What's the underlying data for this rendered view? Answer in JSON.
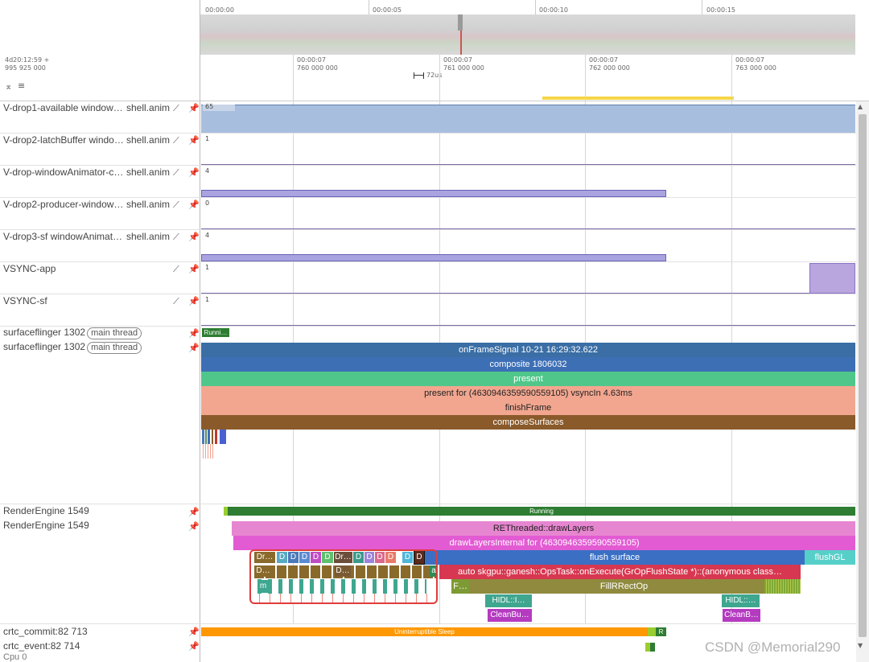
{
  "overview": {
    "ticks": [
      "00:00:00",
      "00:00:05",
      "00:00:10",
      "00:00:15"
    ]
  },
  "timeline": {
    "offset_line1": "4d20:12:59  +",
    "offset_line2": "995 925 000",
    "ticks": [
      {
        "l1": "00:00:07",
        "l2": "760 000 000"
      },
      {
        "l1": "00:00:07",
        "l2": "761 000 000"
      },
      {
        "l1": "00:00:07",
        "l2": "762 000 000"
      },
      {
        "l1": "00:00:07",
        "l2": "763 000 000"
      }
    ],
    "scale_label": "72us"
  },
  "tracks": [
    {
      "name": "V-drop1-available window…",
      "proc": "shell.anim",
      "value": "65"
    },
    {
      "name": "V-drop2-latchBuffer windo…",
      "proc": "shell.anim",
      "value": "1"
    },
    {
      "name": "V-drop-windowAnimator-c…",
      "proc": "shell.anim",
      "value": "4"
    },
    {
      "name": "V-drop2-producer-window…",
      "proc": "shell.anim",
      "value": "0"
    },
    {
      "name": "V-drop3-sf windowAnimat…",
      "proc": "shell.anim",
      "value": "4"
    },
    {
      "name": "VSYNC-app",
      "proc": "",
      "value": "1"
    },
    {
      "name": "VSYNC-sf",
      "proc": "",
      "value": "1"
    }
  ],
  "sf_state": {
    "name": "surfaceflinger 1302",
    "badge": "main thread",
    "state": "Runni…"
  },
  "sf_main": {
    "name": "surfaceflinger 1302",
    "badge": "main thread",
    "slices": [
      {
        "label": "onFrameSignal 10-21 16:29:32.622",
        "color": "#3a6ea5"
      },
      {
        "label": "composite 1806032",
        "color": "#3d6fb5"
      },
      {
        "label": "present",
        "color": "#4fc78a"
      },
      {
        "label": "present for  (4630946359590559105) vsyncIn 4.63ms",
        "color": "#f2a68f"
      },
      {
        "label": "finishFrame",
        "color": "#f2a68f"
      },
      {
        "label": "composeSurfaces",
        "color": "#8a5a2b"
      }
    ]
  },
  "re_state": {
    "name": "RenderEngine 1549",
    "state": "Running"
  },
  "re_main": {
    "name": "RenderEngine 1549",
    "slices": {
      "rethreaded": "REThreaded::drawLayers",
      "drawlayers": "drawLayersInternal for  (4630946359590559105)",
      "flush": "flush surface",
      "flushgl": "flushGL",
      "skgpu": "auto skgpu::ganesh::OpsTask::onExecute(GrOpFlushState *)::(anonymous class…",
      "fillrect": "FillRRectOp",
      "f": "F…",
      "hidl1": "HIDL::I…",
      "hidl2": "HIDL::…",
      "clean1": "CleanBu…",
      "clean2": "CleanB…",
      "small_labels": [
        "Dr…",
        "D",
        "D",
        "D",
        "D",
        "D",
        "Dr…",
        "D",
        "D",
        "D",
        "D",
        "D",
        "D"
      ],
      "row2_labels": [
        "D…",
        "D…",
        "a"
      ],
      "row3_label": "m"
    }
  },
  "crtc": [
    {
      "name": "crtc_commit:82 713",
      "state": "Uninterruptible Sleep",
      "r": "R"
    },
    {
      "name": "crtc_event:82 714"
    }
  ],
  "cpu_label": "Cpu 0",
  "watermark": "CSDN @Memorial290",
  "colors": {
    "highlight_box": "#e03c3c",
    "counter_fill": "#a8bede",
    "counter_purple": "#b9a6df",
    "running_green": "#2e7d32",
    "sleep_orange": "#ff9800"
  }
}
